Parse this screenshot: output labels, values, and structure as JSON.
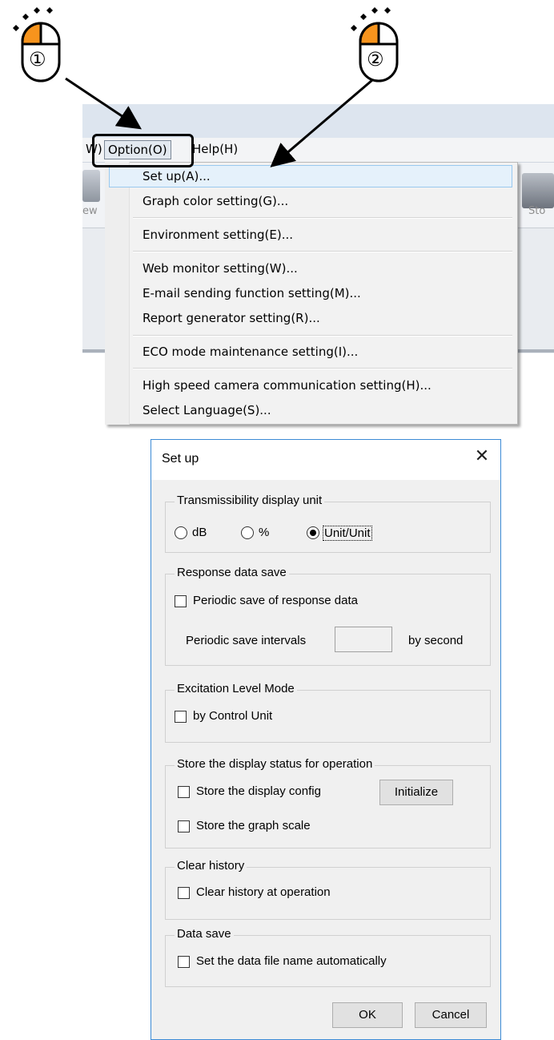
{
  "annotations": {
    "step1": "①",
    "step2": "②"
  },
  "app": {
    "menubar": {
      "partial_left": "W)",
      "option": "Option(O)",
      "help": "Help(H)"
    },
    "toolbar": {
      "left_label": "ew",
      "right_label": "Sto"
    }
  },
  "option_menu": {
    "items": [
      "Set up(A)...",
      "Graph color setting(G)...",
      "Environment setting(E)...",
      "Web monitor setting(W)...",
      "E-mail sending function setting(M)...",
      "Report generator setting(R)...",
      "ECO mode maintenance setting(I)...",
      "High speed camera communication setting(H)...",
      "Select Language(S)..."
    ]
  },
  "dialog": {
    "title": "Set up",
    "close": "✕",
    "transmissibility": {
      "title": "Transmissibility display unit",
      "options": [
        "dB",
        "%",
        "Unit/Unit"
      ],
      "selected": "Unit/Unit"
    },
    "response_save": {
      "title": "Response data save",
      "periodic_label": "Periodic save of response data",
      "interval_label": "Periodic save intervals",
      "interval_value": "",
      "unit": "by second"
    },
    "excitation": {
      "title": "Excitation Level Mode",
      "option": "by Control Unit"
    },
    "display_status": {
      "title": "Store the display status for operation",
      "store_config": "Store the display config",
      "initialize": "Initialize",
      "store_scale": "Store the graph scale"
    },
    "clear_history": {
      "title": "Clear history",
      "option": "Clear history at operation"
    },
    "data_save": {
      "title": "Data save",
      "option": "Set the data file name automatically"
    },
    "ok": "OK",
    "cancel": "Cancel"
  },
  "colors": {
    "mouse_button": "#f7941d",
    "highlight": "#e5f1fb",
    "dialog_border": "#3c8bd6"
  }
}
